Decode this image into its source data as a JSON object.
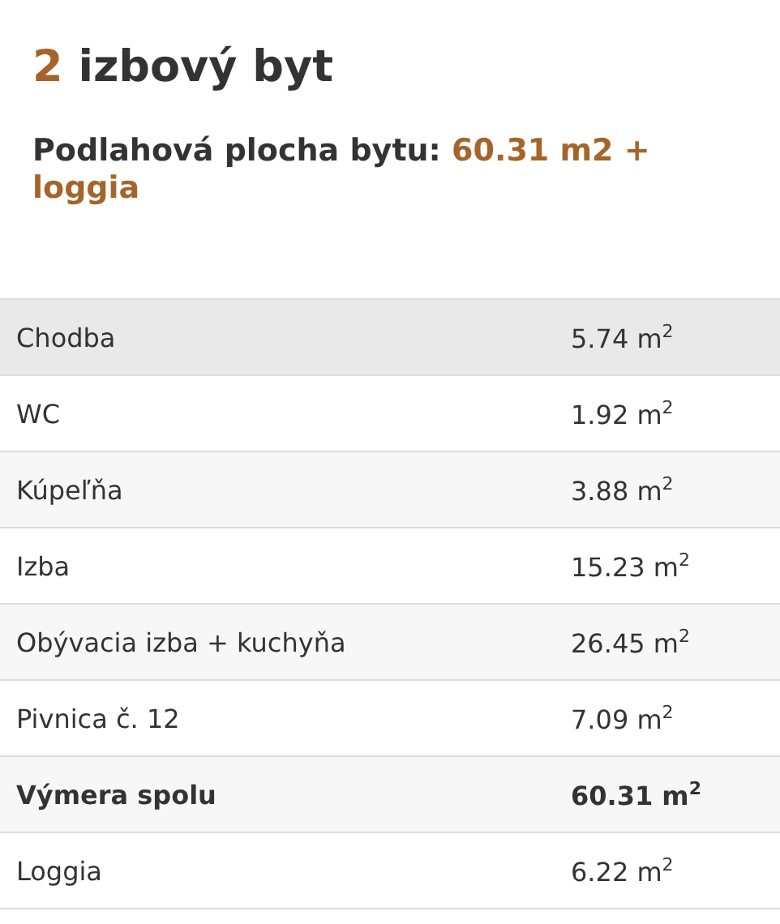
{
  "title": {
    "number": "2",
    "text": "izbový byt"
  },
  "area": {
    "label": "Podlahová plocha bytu:",
    "value": "60.31 m2 + loggia"
  },
  "rooms": [
    {
      "name": "Chodba",
      "area": "5.74 m$^{2}$",
      "highlighted": true,
      "kind": "room"
    },
    {
      "name": "WC",
      "area": "1.92 m$^{2}$",
      "highlighted": false,
      "kind": "room"
    },
    {
      "name": "Kúpeľňa",
      "area": "3.88 m$^{2}$",
      "highlighted": false,
      "kind": "room"
    },
    {
      "name": "Izba",
      "area": "15.23 m$^{2}$",
      "highlighted": false,
      "kind": "room"
    },
    {
      "name": "Obývacia izba + kuchyňa",
      "area": "26.45 m$^{2}$",
      "highlighted": false,
      "kind": "room"
    },
    {
      "name": "Pivnica č. 12",
      "area": "7.09 m$^{2}$",
      "highlighted": false,
      "kind": "room"
    },
    {
      "name": "Výmera spolu",
      "area": "60.31 m$^{2}$",
      "highlighted": false,
      "kind": "total"
    },
    {
      "name": "Loggia",
      "area": "6.22 m$^{2}$",
      "highlighted": false,
      "kind": "room"
    }
  ]
}
